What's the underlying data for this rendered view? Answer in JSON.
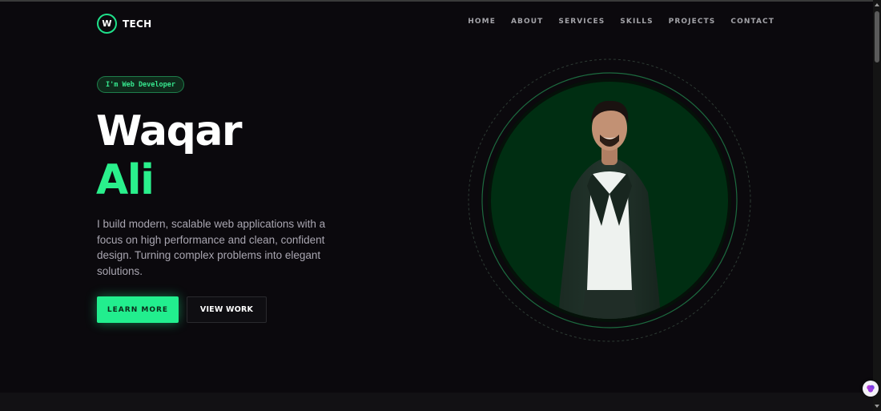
{
  "brand": {
    "badge": "W",
    "name": "TECH"
  },
  "nav": {
    "items": [
      "HOME",
      "ABOUT",
      "SERVICES",
      "SKILLS",
      "PROJECTS",
      "CONTACT"
    ]
  },
  "hero": {
    "tag": "I'm Web Developer",
    "first_name": "Waqar",
    "last_name": "Ali",
    "description": "I build modern, scalable web applications with a focus on high performance and clean, confident design. Turning complex problems into elegant solutions.",
    "primary_button": "LEARN MORE",
    "secondary_button": "VIEW WORK"
  },
  "colors": {
    "accent": "#22ee8e",
    "background": "#0b090d",
    "portrait_bg": "#002e12"
  },
  "icons": {
    "logo": "w-badge-icon",
    "floating": "brain-icon"
  }
}
